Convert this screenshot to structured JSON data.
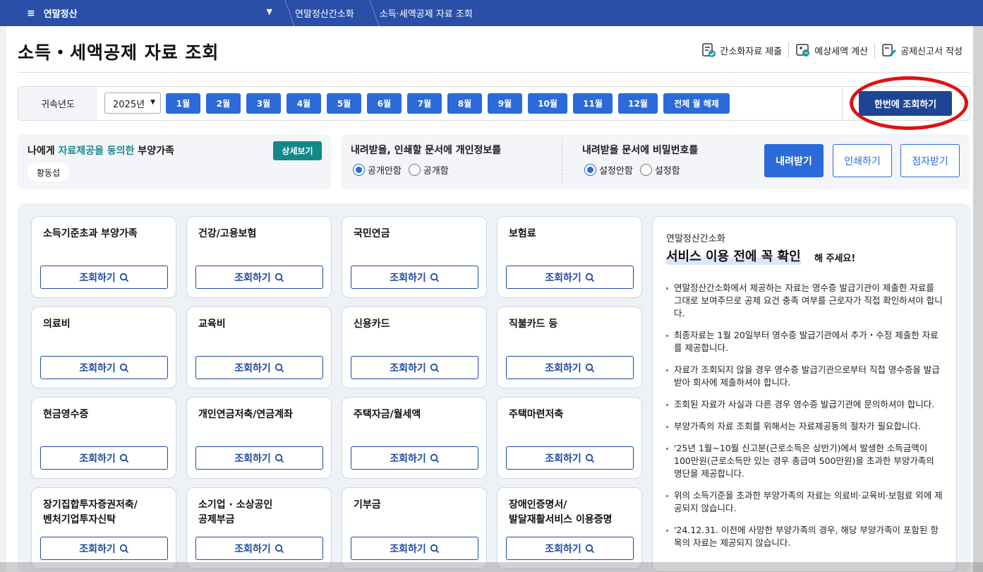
{
  "nav": {
    "menu_label": "연말정산",
    "crumbs": [
      "연말정산간소화",
      "소득·세액공제 자료 조회"
    ]
  },
  "page": {
    "title": "소득・세액공제 자료 조회",
    "actions": [
      "간소화자료 제출",
      "예상세액 계산",
      "공제신고서 작성"
    ]
  },
  "filter": {
    "label": "귀속년도",
    "year": "2025년",
    "months": [
      "1월",
      "2월",
      "3월",
      "4월",
      "5월",
      "6월",
      "7월",
      "8월",
      "9월",
      "10월",
      "11월",
      "12월",
      "전체 월 해제"
    ],
    "query_all": "한번에 조회하기"
  },
  "dependents": {
    "prefix": "나에게 ",
    "highlight": "자료제공을 동의한",
    "suffix": " 부양가족",
    "detail_button": "상세보기",
    "name": "황동섭"
  },
  "privacy": {
    "q1": "내려받을, 인쇄할 문서에 개인정보를",
    "q1_opt1": "공개안함",
    "q1_opt2": "공개함",
    "q2": "내려받을 문서에 비밀번호를",
    "q2_opt1": "설정안함",
    "q2_opt2": "설정함",
    "download": "내려받기",
    "print": "인쇄하기",
    "braille": "점자받기"
  },
  "query_label": "조회하기",
  "cards": [
    [
      "소득기준초과 부양가족"
    ],
    [
      "건강/고용보험"
    ],
    [
      "국민연금"
    ],
    [
      "보험료"
    ],
    [
      "의료비"
    ],
    [
      "교육비"
    ],
    [
      "신용카드"
    ],
    [
      "직불카드 등"
    ],
    [
      "현금영수증"
    ],
    [
      "개인연금저축/연금계좌"
    ],
    [
      "주택자금/월세액"
    ],
    [
      "주택마련저축"
    ],
    [
      "장기집합투자증권저축/",
      "벤처기업투자신탁"
    ],
    [
      "소기업 · 소상공인",
      "공제부금"
    ],
    [
      "기부금"
    ],
    [
      "장애인증명서/",
      "발달재활서비스 이용증명"
    ]
  ],
  "notice": {
    "kicker": "연말정산간소화",
    "headline": "서비스 이용 전에 꼭 확인",
    "tail": "해 주세요!",
    "items": [
      "연말정산간소화에서 제공하는 자료는 영수증 발급기관이 제출한 자료를 그대로 보여주므로 공제 요건 충족 여부를 근로자가 직접 확인하셔야 합니다.",
      "최종자료는 1월 20일부터 영수증 발급기관에서 추가・수정 제출한 자료를 제공합니다.",
      "자료가 조회되지 않을 경우 영수증 발급기관으로부터 직접 영수증을 발급받아 회사에 제출하셔야 합니다.",
      "조회된 자료가 사실과 다른 경우 영수증 발급기관에 문의하셔야 합니다.",
      "부양가족의 자료 조회를 위해서는 자료제공동의 절차가 필요합니다.",
      "'25년 1월~10월 신고분(근로소득은 상반기)에서 발생한 소득금액이 100만원(근로소득만 있는 경우 총급여 500만원)을 초과한 부양가족의 명단을 제공합니다.",
      "위의 소득기준을 초과한 부양가족의 자료는 의료비·교육비·보험료 외에 제공되지 않습니다.",
      "'24.12.31. 이전에 사망한 부양가족의 경우, 해당 부양가족이 포함된 항목의 자료는 제공되지 않습니다."
    ]
  },
  "colors": {
    "nav": "#2a4fa8",
    "primary": "#2b6ad9",
    "dark": "#1d4594",
    "teal": "#12888b",
    "ring": "#e01010"
  }
}
